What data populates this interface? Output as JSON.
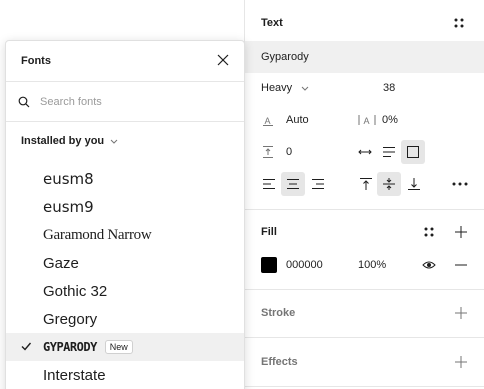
{
  "text_section": {
    "title": "Text",
    "font_name": "Gyparody",
    "weight": "Heavy",
    "size": "38",
    "line_height": "Auto",
    "letter_spacing": "0%",
    "paragraph_spacing": "0"
  },
  "fill_section": {
    "title": "Fill",
    "hex": "000000",
    "opacity": "100%",
    "color": "#000000"
  },
  "stroke_section": {
    "title": "Stroke"
  },
  "effects_section": {
    "title": "Effects"
  },
  "font_popup": {
    "title": "Fonts",
    "search_placeholder": "Search fonts",
    "group_label": "Installed by you",
    "new_badge": "New",
    "fonts": [
      "eusm8",
      "eusm9",
      "Garamond Narrow",
      "Gaze",
      "Gothic 32",
      "Gregory",
      "Gyparody",
      "Interstate"
    ],
    "selected_font": "Gyparody"
  },
  "icons": [
    "close-icon",
    "search-icon",
    "chevron-down-icon",
    "check-icon",
    "grid-dots-icon",
    "plus-icon",
    "minus-icon",
    "eye-icon",
    "more-icon"
  ]
}
